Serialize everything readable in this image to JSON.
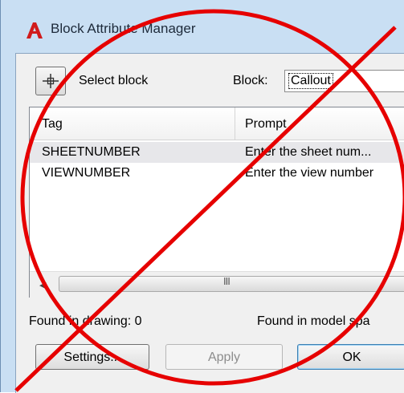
{
  "window": {
    "title": "Block Attribute Manager",
    "app_icon": "autocad-a-icon"
  },
  "toolbar": {
    "select_block_label": "Select block",
    "block_label": "Block:",
    "block_value": "Callout"
  },
  "table": {
    "columns": [
      "Tag",
      "Prompt"
    ],
    "rows": [
      {
        "tag": "SHEETNUMBER",
        "prompt": "Enter the sheet num..."
      },
      {
        "tag": "VIEWNUMBER",
        "prompt": "Enter the view number"
      }
    ],
    "selected_row": 0
  },
  "status": {
    "found_in_drawing": "Found in drawing: 0",
    "found_in_model_space": "Found in model spa"
  },
  "buttons": {
    "settings": "Settings...",
    "apply": "Apply",
    "ok": "OK"
  },
  "overlay": {
    "symbol": "prohibition-sign",
    "color": "#e60000"
  }
}
